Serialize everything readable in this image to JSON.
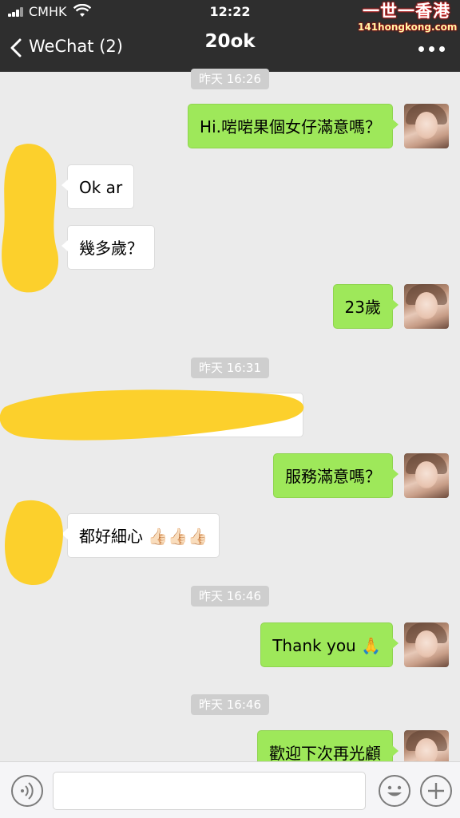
{
  "status_bar": {
    "carrier": "CMHK",
    "time": "12:22"
  },
  "watermark": {
    "top": "一世一香港",
    "bottom": "141hongkong.com"
  },
  "nav": {
    "back_label": "WeChat (2)",
    "title": "20ok"
  },
  "timestamps": [
    "昨天 16:26",
    "昨天 16:31",
    "昨天 16:46",
    "昨天 16:46"
  ],
  "messages": [
    {
      "side": "out",
      "text": "Hi.啱啱果個女仔滿意嗎？"
    },
    {
      "side": "in",
      "text": "Ok ar"
    },
    {
      "side": "in",
      "text": "幾多歲？"
    },
    {
      "side": "out",
      "text": "23歲"
    },
    {
      "side": "in",
      "text": ""
    },
    {
      "side": "out",
      "text": "服務滿意嗎？"
    },
    {
      "side": "in",
      "text": "都好細心",
      "emoji": "👍🏻👍🏻👍🏻"
    },
    {
      "side": "out",
      "text": "Thank you",
      "emoji": "🙏"
    },
    {
      "side": "out",
      "text": "歡迎下次再光顧"
    }
  ],
  "input_bar": {
    "placeholder": ""
  },
  "colors": {
    "header_bg": "#2e2e2e",
    "chat_bg": "#ebebeb",
    "outgoing_bubble": "#9ee85a",
    "incoming_bubble": "#ffffff",
    "timestamp_bg": "#cecece",
    "redaction": "#fcd02c"
  },
  "icons": {
    "back": "chevron-left-icon",
    "more": "more-dots-icon",
    "voice": "voice-icon",
    "emoji": "emoji-icon",
    "add": "plus-icon",
    "wifi": "wifi-icon",
    "signal": "signal-icon"
  }
}
